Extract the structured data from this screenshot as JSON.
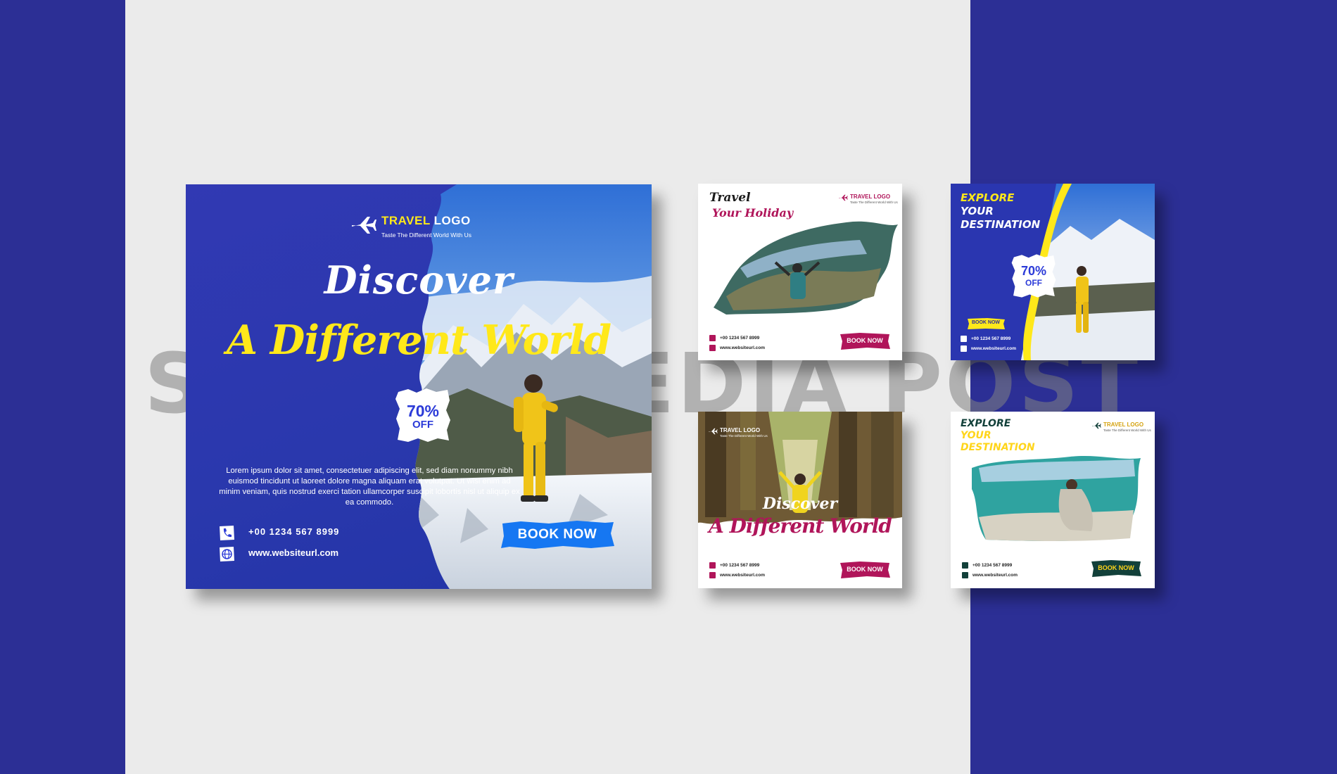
{
  "watermark": "SOCIAL MEDIA POST",
  "colors": {
    "brand_blue": "#2c2f95",
    "accent_yellow": "#ffe81a",
    "accent_magenta": "#b0155a",
    "dark_green": "#12403a",
    "light_gray": "#ebebeb"
  },
  "main_post": {
    "logo_name_1": "TRAVEL",
    "logo_name_2": "LOGO",
    "logo_tagline": "Taste The Different World With Us",
    "headline_1": "Discover",
    "headline_2": "A Different World",
    "discount_percent": "70%",
    "discount_off": "OFF",
    "body_text": "Lorem ipsum dolor sit amet, consectetuer adipiscing elit, sed diam nonummy nibh euismod tincidunt ut laoreet dolore magna aliquam erat volutpat. Ut wisi enim ad minim veniam, quis nostrud exerci tation ullamcorper suscipit lobortis nisl ut aliquip ex ea commodo.",
    "phone": "+00  1234  567  8999",
    "website": "www.websiteurl.com",
    "cta": "BOOK NOW",
    "icons": [
      "plane-icon",
      "phone-icon",
      "globe-icon"
    ]
  },
  "post_a": {
    "headline_1": "Travel",
    "headline_2": "Your Holiday",
    "logo_name": "TRAVEL LOGO",
    "logo_tagline": "Taste The Different World With Us",
    "phone": "+00 1234 567 8999",
    "website": "www.websiteurl.com",
    "cta": "BOOK NOW"
  },
  "post_b": {
    "headline_1": "EXPLORE",
    "headline_2": "YOUR",
    "headline_3": "DESTINATION",
    "discount_percent": "70%",
    "discount_off": "OFF",
    "phone": "+00 1234 567 8999",
    "website": "www.websiteurl.com",
    "cta": "BOOK NOW"
  },
  "post_c": {
    "logo_name": "TRAVEL LOGO",
    "logo_tagline": "Taste The Different World With Us",
    "headline_1": "Discover",
    "headline_2": "A Different World",
    "phone": "+00 1234 567 8999",
    "website": "www.websiteurl.com",
    "cta": "BOOK NOW"
  },
  "post_d": {
    "headline_1": "EXPLORE",
    "headline_2": "YOUR",
    "headline_3": "DESTINATION",
    "logo_name": "TRAVEL LOGO",
    "logo_tagline": "Taste The Different World With Us",
    "phone": "+00 1234 567 8999",
    "website": "www.websiteurl.com",
    "cta": "BOOK NOW"
  }
}
